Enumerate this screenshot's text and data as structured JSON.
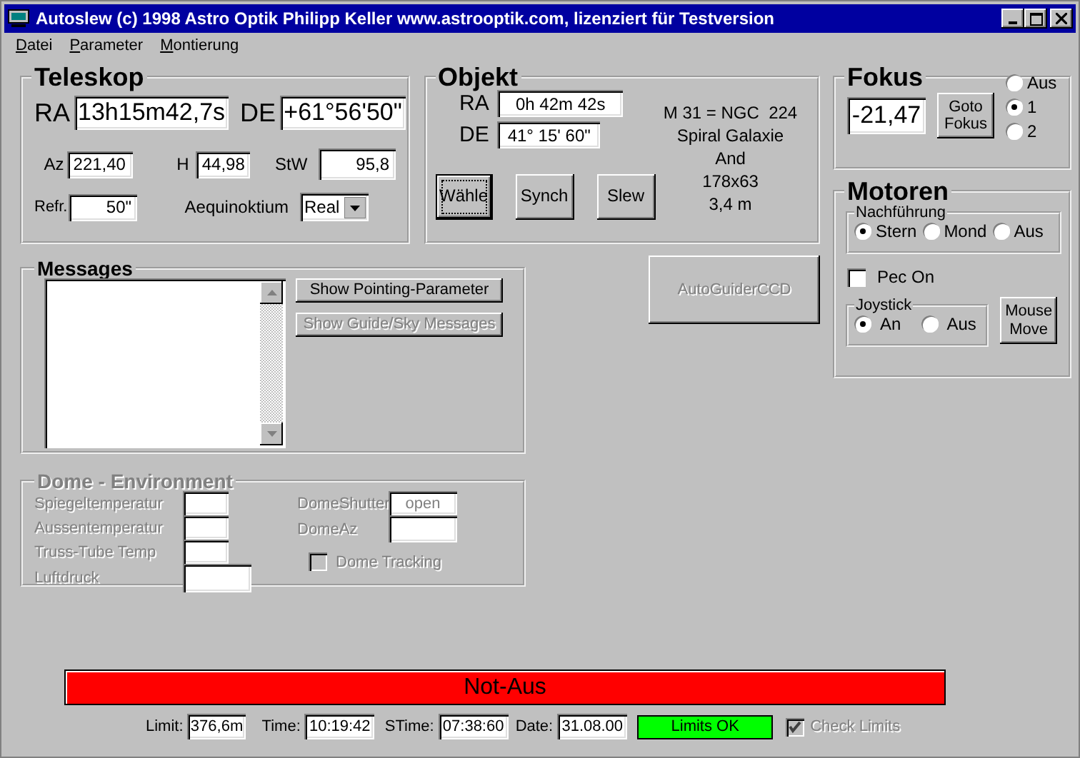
{
  "window": {
    "title": "Autoslew (c) 1998 Astro Optik Philipp Keller www.astrooptik.com, lizenziert für Testversion"
  },
  "menu": [
    {
      "label": "Datei"
    },
    {
      "label": "Parameter"
    },
    {
      "label": "Montierung"
    }
  ],
  "teleskop": {
    "title": "Teleskop",
    "ra_label": "RA",
    "ra": "13h15m42,7s",
    "de_label": "DE",
    "de": "+61°56'50\"",
    "az_label": "Az",
    "az": "221,40",
    "h_label": "H",
    "h": "44,98",
    "stw_label": "StW",
    "stw": "95,8",
    "refr_label": "Refr.",
    "refr": "50\"",
    "aequinoktium_label": "Aequinoktium",
    "aequinoktium": "Real"
  },
  "objekt": {
    "title": "Objekt",
    "ra_label": "RA",
    "ra": "0h 42m 42s",
    "de_label": "DE",
    "de": "41° 15' 60\"",
    "info": [
      "M 31 = NGC  224",
      "Spiral Galaxie",
      "And",
      "178x63",
      "3,4 m"
    ],
    "buttons": [
      {
        "label": "Wähle",
        "focused": true
      },
      {
        "label": "Synch",
        "focused": false
      },
      {
        "label": "Slew",
        "focused": false
      }
    ]
  },
  "fokus": {
    "title": "Fokus",
    "value": "-21,47",
    "button": "Goto Fokus",
    "options": [
      {
        "label": "Aus",
        "selected": false
      },
      {
        "label": "1",
        "selected": true
      },
      {
        "label": "2",
        "selected": false
      }
    ]
  },
  "motoren": {
    "title": "Motoren",
    "nachfuehrung": {
      "title": "Nachführung",
      "options": [
        {
          "label": "Stern",
          "selected": true
        },
        {
          "label": "Mond",
          "selected": false
        },
        {
          "label": "Aus",
          "selected": false
        }
      ]
    },
    "pec": {
      "label": "Pec On",
      "checked": false
    },
    "joystick": {
      "title": "Joystick",
      "options": [
        {
          "label": "An",
          "selected": true
        },
        {
          "label": "Aus",
          "selected": false
        }
      ]
    },
    "mouse_move": "Mouse Move"
  },
  "messages": {
    "title": "Messages",
    "buttons": [
      {
        "label": "Show Pointing-Parameter",
        "disabled": false
      },
      {
        "label": "Show Guide/Sky Messages",
        "disabled": true
      }
    ]
  },
  "autoguider": {
    "label": "AutoGuiderCCD",
    "disabled": true
  },
  "dome": {
    "title": "Dome - Environment",
    "disabled": true,
    "fields": [
      {
        "label": "Spiegeltemperatur"
      },
      {
        "label": "Aussentemperatur"
      },
      {
        "label": "Truss-Tube Temp"
      },
      {
        "label": "Luftdruck"
      }
    ],
    "shutter_label": "DomeShutter",
    "shutter": "open",
    "az_label": "DomeAz",
    "tracking": {
      "label": "Dome Tracking",
      "checked": false
    }
  },
  "not_aus": "Not-Aus",
  "status": {
    "limit_label": "Limit:",
    "limit": "376,6m",
    "time_label": "Time:",
    "time": "10:19:42",
    "stime_label": "STime:",
    "stime": "07:38:60",
    "date_label": "Date:",
    "date": "31.08.00",
    "limits": "Limits OK",
    "check_limits": {
      "label": "Check Limits",
      "checked": true,
      "disabled": true
    }
  }
}
